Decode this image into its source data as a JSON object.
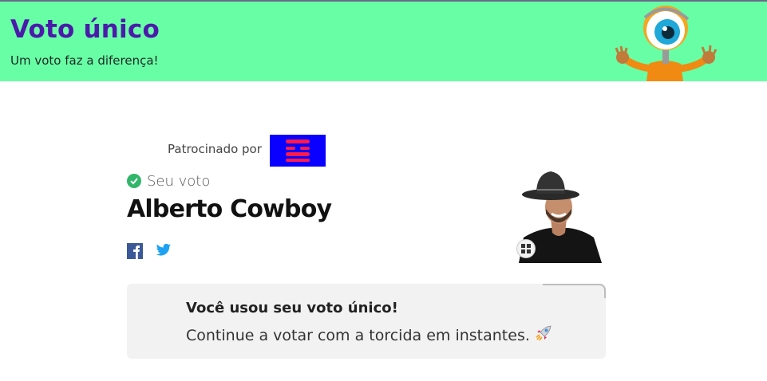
{
  "header": {
    "title": "Voto único",
    "subtitle": "Um voto faz a diferença!",
    "background_color": "#68fea5",
    "title_color": "#4b1aab",
    "mascot_icon": "big-brother-eye-mascot"
  },
  "sponsor": {
    "label": "Patrocinado por",
    "logo_icon": "sponsor-logo",
    "logo_color": "#0a00ff"
  },
  "vote": {
    "label": "Seu voto",
    "check_color": "#32b66a",
    "candidate_name": "Alberto Cowboy",
    "photo_icon": "candidate-photo",
    "expand_icon": "expand-icon"
  },
  "social": {
    "facebook_icon": "facebook-icon",
    "twitter_icon": "twitter-icon"
  },
  "notice": {
    "title": "Você usou seu voto único!",
    "text": "Continue a votar com a torcida em instantes.",
    "emoji_icon": "rocket-icon"
  }
}
